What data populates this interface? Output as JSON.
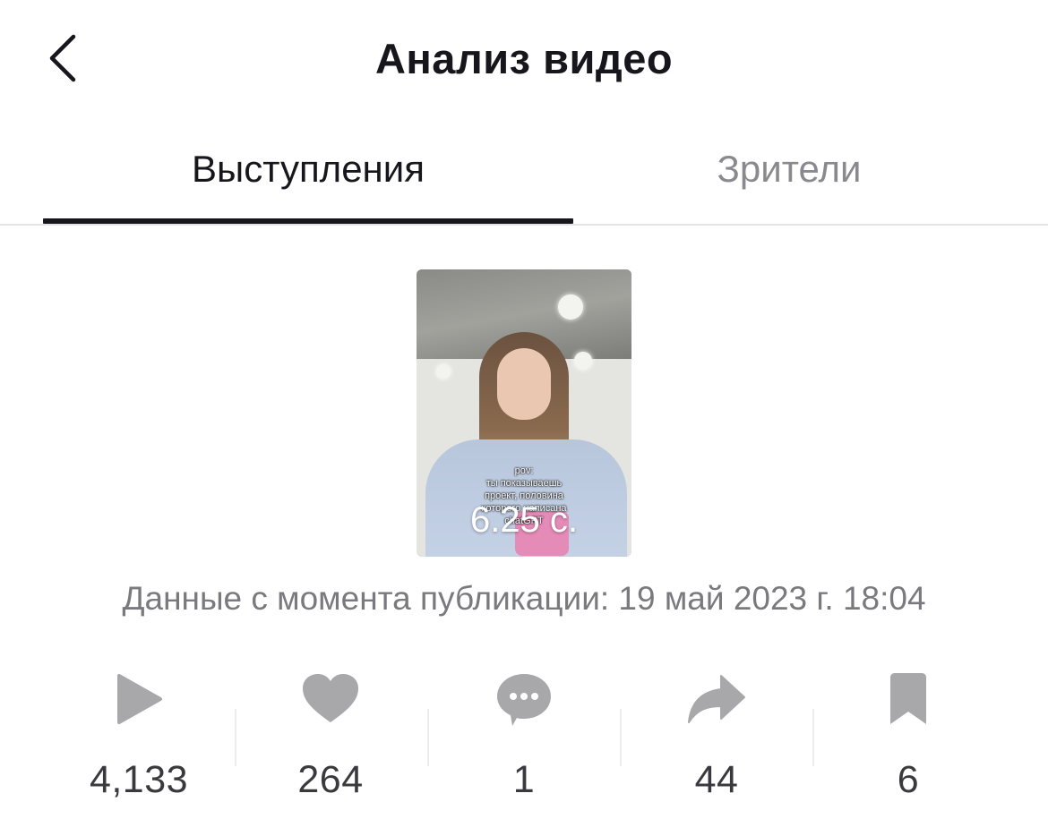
{
  "header": {
    "title": "Анализ видео",
    "back_icon": "chevron-left-icon"
  },
  "tabs": [
    {
      "label": "Выступления",
      "active": true
    },
    {
      "label": "Зрители",
      "active": false
    }
  ],
  "video": {
    "caption": [
      "pov:",
      "ты показываешь",
      "проект, половина",
      "которого написана",
      "chatGPT"
    ],
    "duration": "6.25 с."
  },
  "published": "Данные с момента публикации: 19 май 2023 г. 18:04",
  "stats": [
    {
      "icon": "play-icon",
      "value": "4,133"
    },
    {
      "icon": "heart-icon",
      "value": "264"
    },
    {
      "icon": "comment-icon",
      "value": "1"
    },
    {
      "icon": "share-icon",
      "value": "44"
    },
    {
      "icon": "bookmark-icon",
      "value": "6"
    }
  ],
  "colors": {
    "text_primary": "#16161c",
    "text_secondary": "#8a8a8e",
    "icon_gray": "#a8a8ab"
  }
}
